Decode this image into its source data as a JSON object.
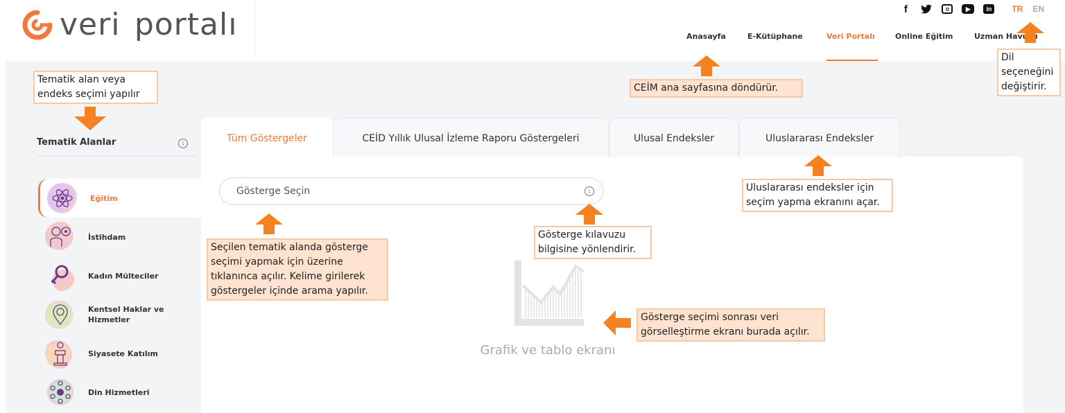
{
  "logo": {
    "text_prefix": "veri",
    "text_suffix": "porta",
    "text_end": "lı"
  },
  "social": {
    "facebook": "f",
    "twitter": "♥",
    "instagram": "▣",
    "youtube": "▶",
    "linkedin": "in"
  },
  "languages": {
    "tr": "TR",
    "en": "EN"
  },
  "nav": {
    "items": [
      "Anasayfa",
      "E-Kütüphane",
      "Veri Portalı",
      "Online Eğitim",
      "Uzman Havuzu"
    ],
    "active_index": 2
  },
  "sidebar": {
    "title": "Tematik Alanlar",
    "info": "i",
    "items": [
      {
        "label": "Eğitim",
        "active": true
      },
      {
        "label": "İstihdam"
      },
      {
        "label": "Kadın Mülteciler"
      },
      {
        "label": "Kentsel Haklar ve Hizmetler"
      },
      {
        "label": "Siyasete Katılım"
      },
      {
        "label": "Din Hizmetleri"
      }
    ]
  },
  "tabs": [
    "Tüm Göstergeler",
    "CEİD Yıllık Ulusal İzleme Raporu Göstergeleri",
    "Ulusal Endeksler",
    "Uluslararası Endeksler"
  ],
  "search": {
    "placeholder": "Gösterge Seçin",
    "info": "i"
  },
  "chart_placeholder": {
    "caption": "Grafik ve tablo ekranı"
  },
  "annotations": {
    "tematik": "Tematik alan veya endeks seçimi yapılır",
    "ceim": "CEİM ana sayfasına döndürür.",
    "dil": "Dil seçeneğini değiştirir.",
    "uluslararasi": "Uluslararası endeksler için seçim yapma ekranını açar.",
    "kilavuz": "Gösterge kılavuzu bilgisine yönlendirir.",
    "secilen": "Seçilen tematik alanda gösterge seçimi yapmak için üzerine tıklanınca açılır. Kelime girilerek göstergeler içinde arama yapılır.",
    "grafik": "Gösterge seçimi sonrası veri görselleştirme ekranı burada açılır."
  },
  "colors": {
    "accent": "#f07a3a",
    "note_bg": "#fde3d0",
    "arrow": "#f58220"
  }
}
